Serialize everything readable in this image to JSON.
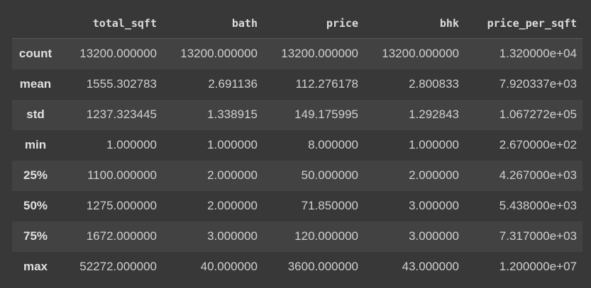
{
  "table": {
    "columns": [
      "total_sqft",
      "bath",
      "price",
      "bhk",
      "price_per_sqft"
    ],
    "rows": [
      {
        "label": "count",
        "values": [
          "13200.000000",
          "13200.000000",
          "13200.000000",
          "13200.000000",
          "1.320000e+04"
        ]
      },
      {
        "label": "mean",
        "values": [
          "1555.302783",
          "2.691136",
          "112.276178",
          "2.800833",
          "7.920337e+03"
        ]
      },
      {
        "label": "std",
        "values": [
          "1237.323445",
          "1.338915",
          "149.175995",
          "1.292843",
          "1.067272e+05"
        ]
      },
      {
        "label": "min",
        "values": [
          "1.000000",
          "1.000000",
          "8.000000",
          "1.000000",
          "2.670000e+02"
        ]
      },
      {
        "label": "25%",
        "values": [
          "1100.000000",
          "2.000000",
          "50.000000",
          "2.000000",
          "4.267000e+03"
        ]
      },
      {
        "label": "50%",
        "values": [
          "1275.000000",
          "2.000000",
          "71.850000",
          "3.000000",
          "5.438000e+03"
        ]
      },
      {
        "label": "75%",
        "values": [
          "1672.000000",
          "3.000000",
          "120.000000",
          "3.000000",
          "7.317000e+03"
        ]
      },
      {
        "label": "max",
        "values": [
          "52272.000000",
          "40.000000",
          "3600.000000",
          "43.000000",
          "1.200000e+07"
        ]
      }
    ]
  }
}
